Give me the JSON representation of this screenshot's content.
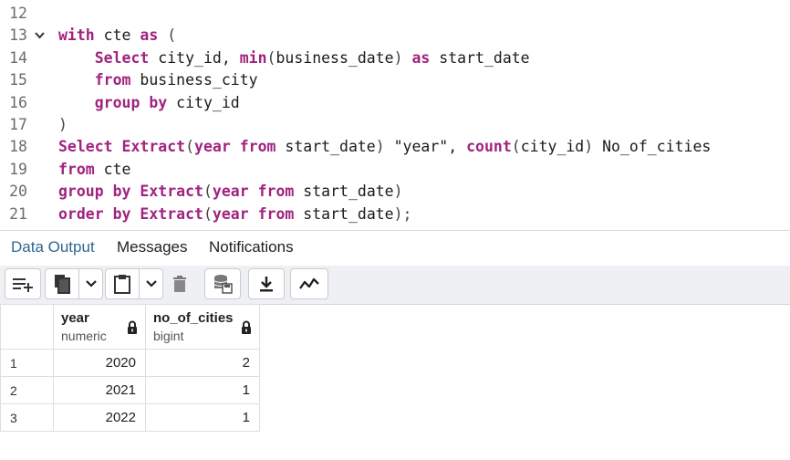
{
  "editor": {
    "lines": [
      {
        "num": "12",
        "fold": "",
        "tokens": []
      },
      {
        "num": "13",
        "fold": "v",
        "tokens": [
          {
            "t": "with",
            "c": "kw"
          },
          {
            "t": " cte ",
            "c": ""
          },
          {
            "t": "as",
            "c": "kw"
          },
          {
            "t": " (",
            "c": "pn"
          }
        ]
      },
      {
        "num": "14",
        "fold": "",
        "tokens": [
          {
            "t": "    ",
            "c": ""
          },
          {
            "t": "Select",
            "c": "kw"
          },
          {
            "t": " city_id, ",
            "c": ""
          },
          {
            "t": "min",
            "c": "fn"
          },
          {
            "t": "(",
            "c": "pn"
          },
          {
            "t": "business_date",
            "c": ""
          },
          {
            "t": ")",
            "c": "pn"
          },
          {
            "t": " ",
            "c": ""
          },
          {
            "t": "as",
            "c": "kw"
          },
          {
            "t": " start_date",
            "c": ""
          }
        ]
      },
      {
        "num": "15",
        "fold": "",
        "tokens": [
          {
            "t": "    ",
            "c": ""
          },
          {
            "t": "from",
            "c": "kw"
          },
          {
            "t": " business_city",
            "c": ""
          }
        ]
      },
      {
        "num": "16",
        "fold": "",
        "tokens": [
          {
            "t": "    ",
            "c": ""
          },
          {
            "t": "group by",
            "c": "kw"
          },
          {
            "t": " city_id",
            "c": ""
          }
        ]
      },
      {
        "num": "17",
        "fold": "",
        "tokens": [
          {
            "t": ")",
            "c": "pn"
          }
        ]
      },
      {
        "num": "18",
        "fold": "",
        "tokens": [
          {
            "t": "Select",
            "c": "kw"
          },
          {
            "t": " ",
            "c": ""
          },
          {
            "t": "Extract",
            "c": "fn"
          },
          {
            "t": "(",
            "c": "pn"
          },
          {
            "t": "year",
            "c": "kw"
          },
          {
            "t": " ",
            "c": ""
          },
          {
            "t": "from",
            "c": "kw"
          },
          {
            "t": " start_date",
            "c": ""
          },
          {
            "t": ")",
            "c": "pn"
          },
          {
            "t": " \"year\", ",
            "c": "str"
          },
          {
            "t": "count",
            "c": "fn"
          },
          {
            "t": "(",
            "c": "pn"
          },
          {
            "t": "city_id",
            "c": ""
          },
          {
            "t": ")",
            "c": "pn"
          },
          {
            "t": " No_of_cities",
            "c": ""
          }
        ]
      },
      {
        "num": "19",
        "fold": "",
        "tokens": [
          {
            "t": "from",
            "c": "kw"
          },
          {
            "t": " cte",
            "c": ""
          }
        ]
      },
      {
        "num": "20",
        "fold": "",
        "tokens": [
          {
            "t": "group by",
            "c": "kw"
          },
          {
            "t": " ",
            "c": ""
          },
          {
            "t": "Extract",
            "c": "fn"
          },
          {
            "t": "(",
            "c": "pn"
          },
          {
            "t": "year",
            "c": "kw"
          },
          {
            "t": " ",
            "c": ""
          },
          {
            "t": "from",
            "c": "kw"
          },
          {
            "t": " start_date",
            "c": ""
          },
          {
            "t": ")",
            "c": "pn"
          }
        ]
      },
      {
        "num": "21",
        "fold": "",
        "tokens": [
          {
            "t": "order by",
            "c": "kw"
          },
          {
            "t": " ",
            "c": ""
          },
          {
            "t": "Extract",
            "c": "fn"
          },
          {
            "t": "(",
            "c": "pn"
          },
          {
            "t": "year",
            "c": "kw"
          },
          {
            "t": " ",
            "c": ""
          },
          {
            "t": "from",
            "c": "kw"
          },
          {
            "t": " start_date",
            "c": ""
          },
          {
            "t": ");",
            "c": "pn"
          }
        ]
      }
    ]
  },
  "tabs": [
    {
      "label": "Data Output",
      "active": true
    },
    {
      "label": "Messages",
      "active": false
    },
    {
      "label": "Notifications",
      "active": false
    }
  ],
  "toolbar": {
    "icons": [
      "add-row-icon",
      "copy-icon",
      "chevron-down-icon",
      "paste-icon",
      "chevron-down-icon",
      "delete-icon",
      "save-data-icon",
      "download-icon",
      "graph-icon"
    ]
  },
  "grid": {
    "columns": [
      {
        "name": "year",
        "type": "numeric",
        "locked": true
      },
      {
        "name": "no_of_cities",
        "type": "bigint",
        "locked": true
      }
    ],
    "rows": [
      {
        "num": "1",
        "year": "2020",
        "no_of_cities": "2"
      },
      {
        "num": "2",
        "year": "2021",
        "no_of_cities": "1"
      },
      {
        "num": "3",
        "year": "2022",
        "no_of_cities": "1"
      }
    ]
  },
  "colors": {
    "accent": "#326690",
    "keyword": "#a0237f",
    "toolbar_bg": "#eef0f3"
  }
}
